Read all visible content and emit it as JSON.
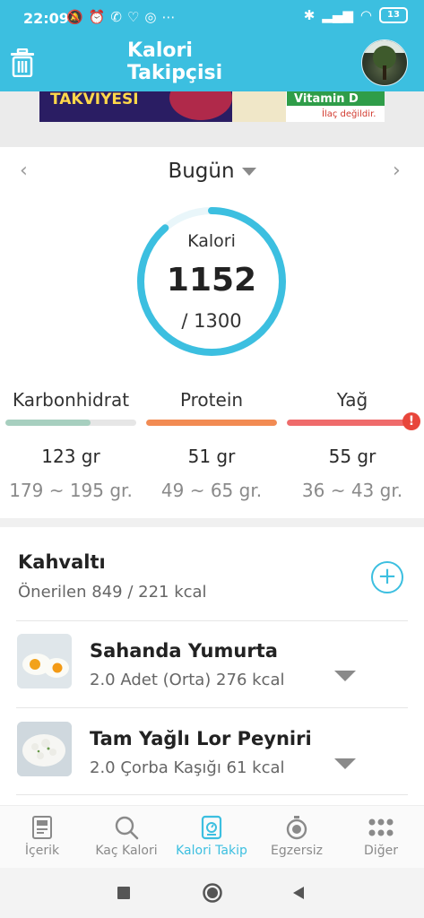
{
  "status_bar": {
    "time": "22:09",
    "battery": "13"
  },
  "app_bar": {
    "title_line1": "Kalori",
    "title_line2": "Takipçisi"
  },
  "ad": {
    "left_text": "TAKVIYESI",
    "right_title": "Vitamin D",
    "right_note": "İlaç değildir."
  },
  "day_nav": {
    "label": "Bugün",
    "prev": "‹",
    "next": "›"
  },
  "calories": {
    "label": "Kalori",
    "value": "1152",
    "target": "/ 1300",
    "progress": 0.886,
    "color": "#3cbfe0"
  },
  "macros": [
    {
      "name": "Karbonhidrat",
      "amount": "123 gr",
      "range": "179 ~ 195 gr.",
      "progress": 0.65,
      "color": "#a7cfbf"
    },
    {
      "name": "Protein",
      "amount": "51 gr",
      "range": "49 ~ 65 gr.",
      "progress": 1.0,
      "color": "#f28b53"
    },
    {
      "name": "Yağ",
      "amount": "55 gr",
      "range": "36 ~ 43 gr.",
      "progress": 1.0,
      "color": "#ef6b6b"
    }
  ],
  "meal": {
    "title": "Kahvaltı",
    "subtitle": "Önerilen 849 / 221 kcal",
    "add": "+",
    "items": [
      {
        "name": "Sahanda Yumurta",
        "detail": "2.0 Adet (Orta) 276 kcal"
      },
      {
        "name": "Tam Yağlı Lor Peyniri",
        "detail": "2.0 Çorba Kaşığı 61 kcal"
      }
    ]
  },
  "bottom_nav": [
    {
      "label": "İçerik",
      "icon": "book-icon"
    },
    {
      "label": "Kaç Kalori",
      "icon": "search-icon"
    },
    {
      "label": "Kalori Takip",
      "icon": "scale-icon",
      "active": true
    },
    {
      "label": "Egzersiz",
      "icon": "stopwatch-icon"
    },
    {
      "label": "Diğer",
      "icon": "grid-icon"
    }
  ]
}
